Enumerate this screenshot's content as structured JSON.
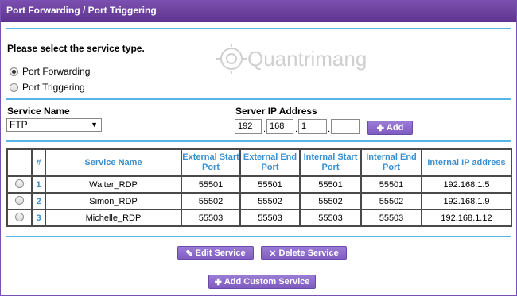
{
  "window": {
    "title": "Port Forwarding / Port Triggering"
  },
  "service_type": {
    "prompt": "Please select the service type.",
    "options": [
      {
        "label": "Port Forwarding",
        "selected": true
      },
      {
        "label": "Port Triggering",
        "selected": false
      }
    ]
  },
  "service": {
    "name_label": "Service Name",
    "selected": "FTP",
    "ip_label": "Server IP Address",
    "ip": [
      "192",
      "168",
      "1",
      ""
    ],
    "add_label": "Add"
  },
  "table": {
    "headers": [
      "#",
      "Service Name",
      "External Start Port",
      "External End Port",
      "Internal Start Port",
      "Internal End Port",
      "Internal IP address"
    ],
    "rows": [
      {
        "num": "1",
        "name": "Walter_RDP",
        "ext_start": "55501",
        "ext_end": "55501",
        "int_start": "55501",
        "int_end": "55501",
        "ip": "192.168.1.5"
      },
      {
        "num": "2",
        "name": "Simon_RDP",
        "ext_start": "55502",
        "ext_end": "55502",
        "int_start": "55502",
        "int_end": "55502",
        "ip": "192.168.1.9"
      },
      {
        "num": "3",
        "name": "Michelle_RDP",
        "ext_start": "55503",
        "ext_end": "55503",
        "int_start": "55503",
        "int_end": "55503",
        "ip": "192.168.1.12"
      }
    ]
  },
  "actions": {
    "edit_label": "Edit Service",
    "delete_label": "Delete Service",
    "add_custom_label": "Add Custom Service"
  },
  "colors": {
    "title_bar": "#6a3d99",
    "rule": "#56b6e8",
    "accent_text": "#3a8fd1",
    "button": "#8a6ac8"
  },
  "watermark": {
    "text": "Quantrimang"
  }
}
